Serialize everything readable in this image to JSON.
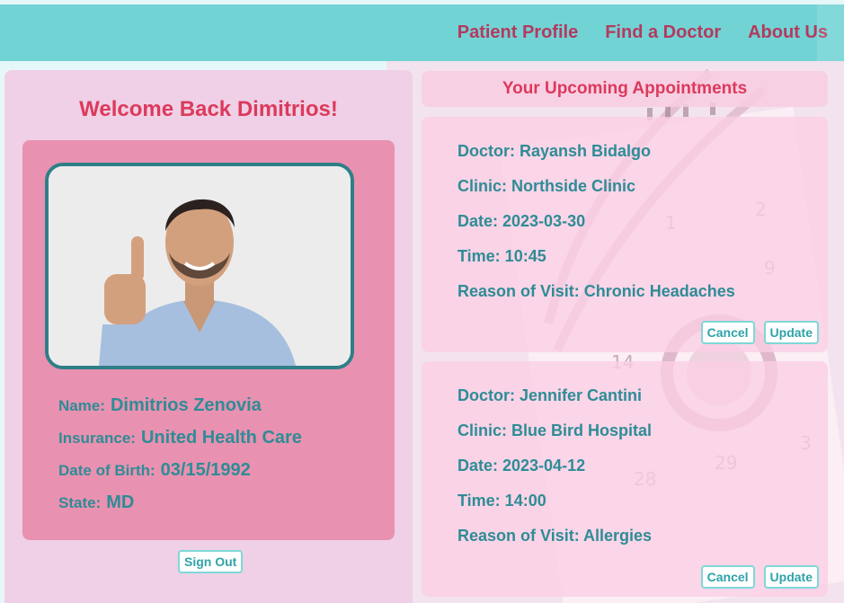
{
  "nav": {
    "items": [
      {
        "label": "Patient Profile"
      },
      {
        "label": "Find a Doctor"
      },
      {
        "label": "About Us"
      }
    ]
  },
  "profile": {
    "welcome": "Welcome Back Dimitrios!",
    "fields": [
      {
        "label": "Name:",
        "value": "Dimitrios Zenovia"
      },
      {
        "label": "Insurance:",
        "value": "United Health Care"
      },
      {
        "label": "Date of Birth:",
        "value": "03/15/1992"
      },
      {
        "label": "State:",
        "value": "MD"
      }
    ],
    "sign_out_label": "Sign Out"
  },
  "appointments": {
    "title": "Your Upcoming Appointments",
    "items": [
      {
        "doctor": "Doctor: Rayansh Bidalgo",
        "clinic": "Clinic: Northside Clinic",
        "date": "Date: 2023-03-30",
        "time": "Time: 10:45",
        "reason": "Reason of Visit: Chronic Headaches",
        "cancel_label": "Cancel",
        "update_label": "Update"
      },
      {
        "doctor": "Doctor: Jennifer Cantini",
        "clinic": "Clinic: Blue Bird Hospital",
        "date": "Date: 2023-04-12",
        "time": "Time: 14:00",
        "reason": "Reason of Visit: Allergies",
        "cancel_label": "Cancel",
        "update_label": "Update"
      }
    ]
  },
  "colors": {
    "topbar": "#72d3d5",
    "nav_text": "#b33a5e",
    "accent_title": "#dc3a5c",
    "teal_text": "#2e8c96",
    "card_pink": "#e991b0"
  }
}
